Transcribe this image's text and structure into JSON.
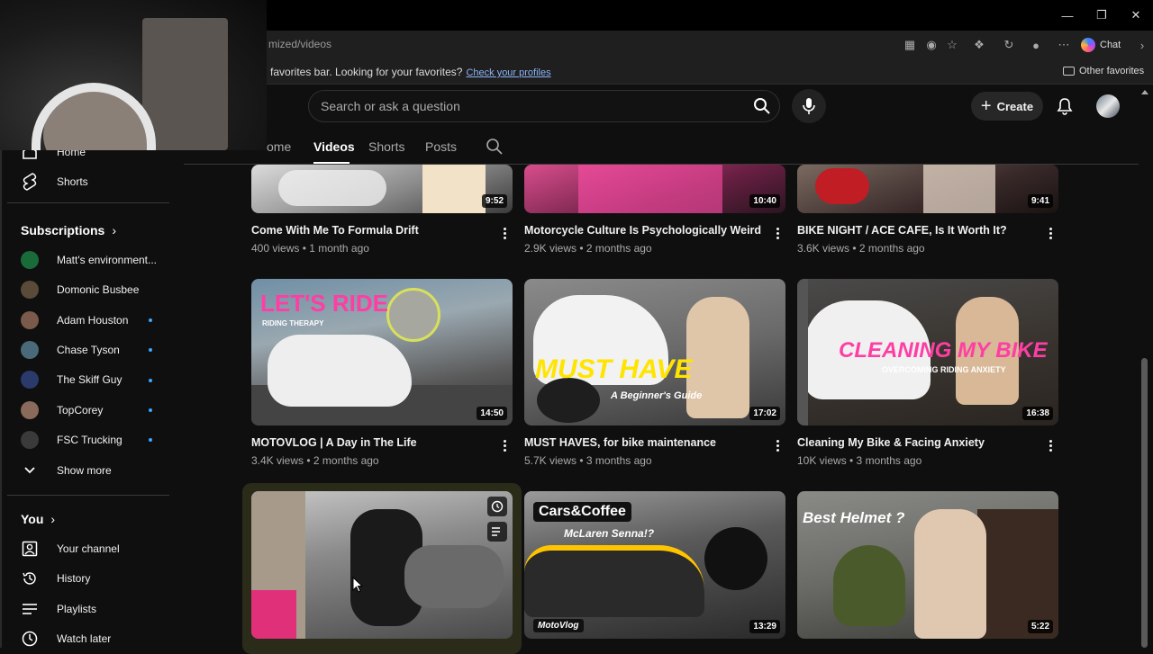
{
  "browser": {
    "url": "mized/videos",
    "chat_label": "Chat",
    "favorites_message": "favorites bar. Looking for your favorites?",
    "favorites_link": "Check your profiles",
    "other_favorites": "Other favorites"
  },
  "header": {
    "search_placeholder": "Search or ask a question",
    "create_label": "Create"
  },
  "tabs": [
    {
      "label": "Home",
      "visible_text": "ome"
    },
    {
      "label": "Videos",
      "active": true
    },
    {
      "label": "Shorts"
    },
    {
      "label": "Posts"
    }
  ],
  "sidebar": {
    "top_items": [
      {
        "label": "Home",
        "icon": "home-icon"
      },
      {
        "label": "Shorts",
        "icon": "shorts-icon"
      }
    ],
    "subscriptions_title": "Subscriptions",
    "subscriptions": [
      {
        "label": "Matt's environment...",
        "avatar_color": "#1a6b3a",
        "new": false
      },
      {
        "label": "Domonic Busbee",
        "avatar_color": "#5a4a3a",
        "new": false
      },
      {
        "label": "Adam Houston",
        "avatar_color": "#7a5a4a",
        "new": true
      },
      {
        "label": "Chase Tyson",
        "avatar_color": "#4a6a7a",
        "new": true
      },
      {
        "label": "The Skiff Guy",
        "avatar_color": "#2a3a6a",
        "new": true
      },
      {
        "label": "TopCorey",
        "avatar_color": "#8a6a5a",
        "new": true
      },
      {
        "label": "FSC Trucking",
        "avatar_color": "#3a3a3a",
        "new": true
      }
    ],
    "show_more": "Show more",
    "you_title": "You",
    "you_items": [
      {
        "label": "Your channel",
        "icon": "channel-icon"
      },
      {
        "label": "History",
        "icon": "history-icon"
      },
      {
        "label": "Playlists",
        "icon": "playlists-icon"
      },
      {
        "label": "Watch later",
        "icon": "watch-later-icon"
      }
    ]
  },
  "videos": [
    {
      "title": "Come With Me To Formula Drift",
      "meta": "400 views • 1 month ago",
      "duration": "9:52"
    },
    {
      "title": "Motorcycle Culture Is Psychologically Weird",
      "meta": "2.9K views • 2 months ago",
      "duration": "10:40"
    },
    {
      "title": "BIKE NIGHT / ACE CAFE, Is It Worth It?",
      "meta": "3.6K views • 2 months ago",
      "duration": "9:41"
    },
    {
      "title": "MOTOVLOG | A Day in The Life",
      "meta": "3.4K views • 2 months ago",
      "duration": "14:50",
      "overlay_main": "LET'S RIDE",
      "overlay_sub": "RIDING THERAPY"
    },
    {
      "title": "MUST HAVES, for bike maintenance",
      "meta": "5.7K views • 3 months ago",
      "duration": "17:02",
      "overlay_main": "MUST HAVE",
      "overlay_sub": "A Beginner's Guide"
    },
    {
      "title": "Cleaning My Bike & Facing Anxiety",
      "meta": "10K views • 3 months ago",
      "duration": "16:38",
      "overlay_main": "CLEANING MY BIKE",
      "overlay_sub": "OVERCOMING RIDING ANXIETY"
    },
    {
      "title": "",
      "meta": "",
      "duration": ""
    },
    {
      "title": "",
      "meta": "",
      "duration": "13:29",
      "overlay_main": "Cars&Coffee",
      "overlay_sub": "McLaren Senna!?",
      "overlay_tag": "MotoVlog"
    },
    {
      "title": "",
      "meta": "",
      "duration": "5:22",
      "overlay_main": "Best Helmet ?"
    }
  ],
  "colors": {
    "accent_blue": "#3ea6ff",
    "pink_overlay": "#ff3ea5",
    "yellow_overlay": "#ffe400"
  }
}
